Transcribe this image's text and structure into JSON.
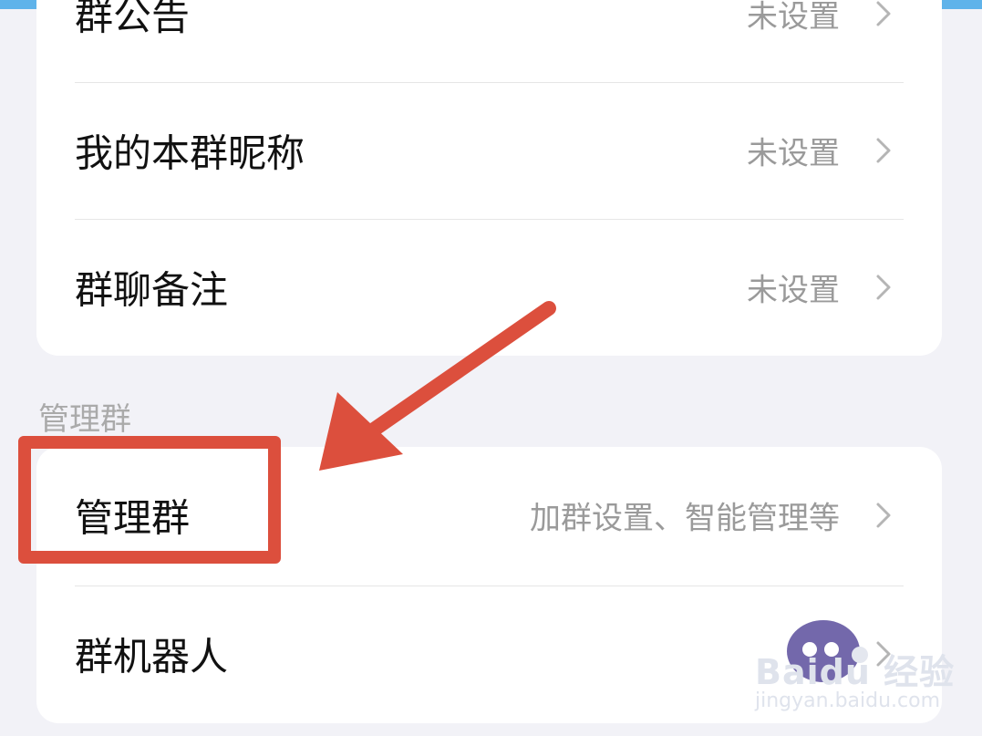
{
  "colors": {
    "accent_red": "#dc4f3d",
    "label": "#111111",
    "secondary": "#9a9a9a"
  },
  "group_info": {
    "items": [
      {
        "label": "群公告",
        "value": "未设置"
      },
      {
        "label": "我的本群昵称",
        "value": "未设置"
      },
      {
        "label": "群聊备注",
        "value": "未设置"
      }
    ]
  },
  "manage_section": {
    "header": "管理群",
    "items": [
      {
        "label": "管理群",
        "value": "加群设置、智能管理等"
      },
      {
        "label": "群机器人",
        "value": ""
      }
    ]
  },
  "watermark": {
    "brand": "Baidu 经验",
    "url": "jingyan.baidu.com"
  }
}
